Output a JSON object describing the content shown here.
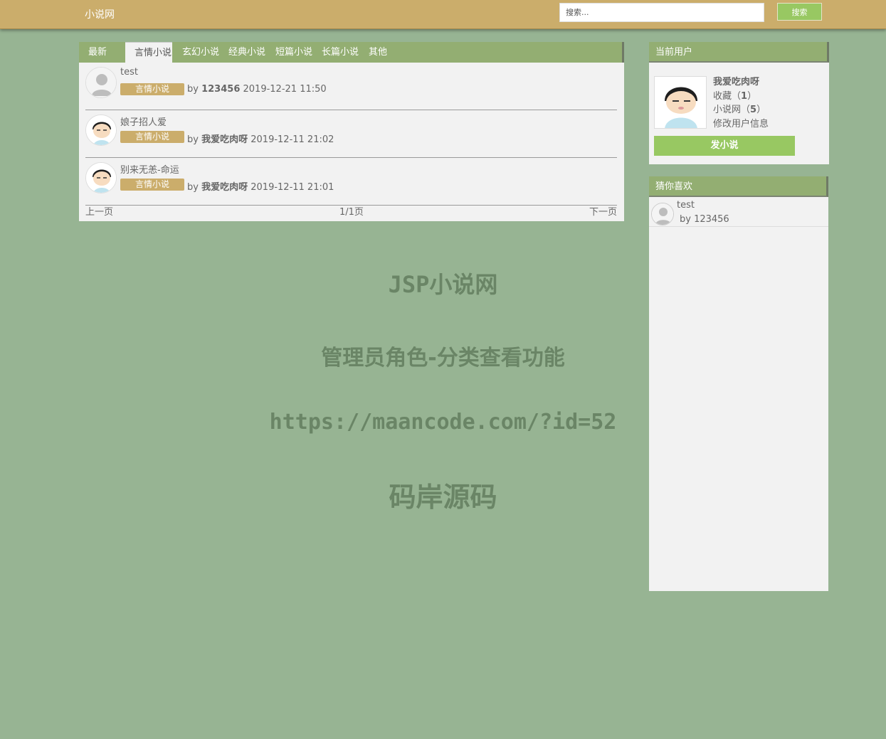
{
  "header": {
    "brand": "小说网",
    "search_placeholder": "搜索...",
    "search_button": "搜索"
  },
  "tabs": [
    {
      "label": "最新"
    },
    {
      "label": "言情小说",
      "active": true
    },
    {
      "label": "玄幻小说"
    },
    {
      "label": "经典小说"
    },
    {
      "label": "短篇小说"
    },
    {
      "label": "长篇小说"
    },
    {
      "label": "其他"
    }
  ],
  "posts": [
    {
      "title": "test",
      "tag": "言情小说",
      "by": "by",
      "author": "123456",
      "time": "2019-12-21 11:50",
      "avatar": "default-avatar-icon"
    },
    {
      "title": "娘子招人爱",
      "tag": "言情小说",
      "by": "by",
      "author": "我爱吃肉呀",
      "time": "2019-12-11 21:02",
      "avatar": "cartoon-avatar-icon"
    },
    {
      "title": "别来无恙-命运",
      "tag": "言情小说",
      "by": "by",
      "author": "我爱吃肉呀",
      "time": "2019-12-11 21:01",
      "avatar": "cartoon-avatar-icon"
    }
  ],
  "pager": {
    "prev": "上一页",
    "page": "1/1页",
    "next": "下一页"
  },
  "user_panel": {
    "title": "当前用户",
    "username": "我爱吃肉呀",
    "favorites_label": "收藏（",
    "favorites_count": "1",
    "favorites_suffix": "）",
    "novels_label": "小说网（",
    "novels_count": "5",
    "novels_suffix": "）",
    "edit_link": "修改用户信息",
    "post_button": "发小说"
  },
  "recommend": {
    "title": "猜你喜欢",
    "items": [
      {
        "title": "test",
        "by": "by 123456"
      }
    ]
  },
  "watermark": {
    "line1": "JSP小说网",
    "line2": "管理员角色-分类查看功能",
    "line3": "https://maancode.com/?id=52",
    "line4": "码岸源码"
  },
  "colors": {
    "background": "#97b493",
    "header": "#cbad6b",
    "panel_head": "#93ae72",
    "accent_button": "#98c862",
    "tag": "#cbad6b"
  }
}
